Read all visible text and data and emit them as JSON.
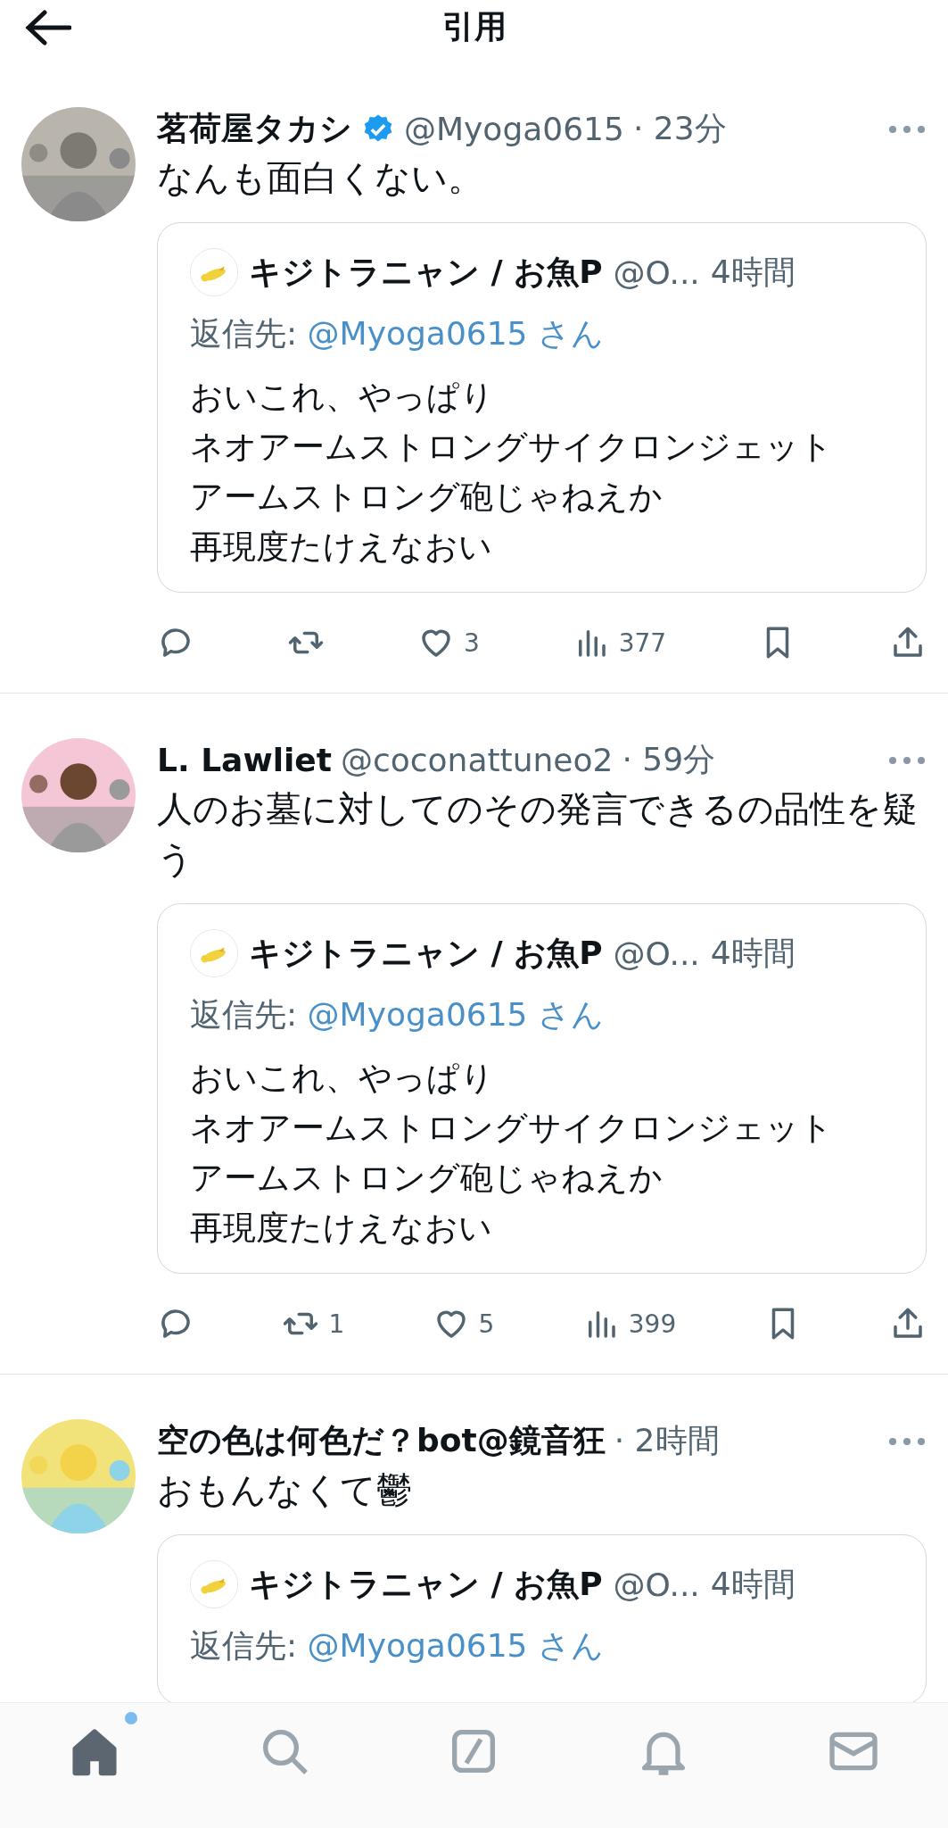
{
  "header": {
    "title": "引用"
  },
  "tweets": [
    {
      "name": "茗荷屋タカシ",
      "verified": true,
      "handle": "@Myoga0615",
      "time": "· 23分",
      "text": "なんも面白くない。",
      "quote": {
        "name": "キジトラニャン / お魚P",
        "handle": "@O...",
        "time": "4時間",
        "reply_label": "返信先:",
        "reply_to": "@Myoga0615 さん",
        "lines": [
          "おいこれ、やっぱり",
          "ネオアームストロングサイクロンジェット",
          "アームストロング砲じゃねえか",
          "再現度たけえなおい"
        ]
      },
      "actions": [
        {
          "kind": "reply"
        },
        {
          "kind": "retweet"
        },
        {
          "kind": "like",
          "count": "3"
        },
        {
          "kind": "views",
          "count": "377"
        },
        {
          "kind": "bookmark"
        },
        {
          "kind": "share"
        }
      ]
    },
    {
      "name": "L. Lawliet",
      "handle": "@coconattuneo2",
      "time": "· 59分",
      "text": "人のお墓に対してのその発言できるの品性を疑う",
      "quote": {
        "name": "キジトラニャン / お魚P",
        "handle": "@O...",
        "time": "4時間",
        "reply_label": "返信先:",
        "reply_to": "@Myoga0615 さん",
        "lines": [
          "おいこれ、やっぱり",
          "ネオアームストロングサイクロンジェット",
          "アームストロング砲じゃねえか",
          "再現度たけえなおい"
        ]
      },
      "actions": [
        {
          "kind": "reply"
        },
        {
          "kind": "retweet",
          "count": "1"
        },
        {
          "kind": "like",
          "count": "5"
        },
        {
          "kind": "views",
          "count": "399"
        },
        {
          "kind": "bookmark"
        },
        {
          "kind": "share"
        }
      ]
    },
    {
      "name": "空の色は何色だ？bot@鏡音狂",
      "time": "· 2時間",
      "text": "おもんなくて鬱",
      "quote": {
        "name": "キジトラニャン / お魚P",
        "handle": "@O...",
        "time": "4時間",
        "reply_label": "返信先:",
        "reply_to": "@Myoga0615 さん"
      }
    }
  ],
  "tab_bar": [
    {
      "kind": "home",
      "selected": true,
      "unread": true
    },
    {
      "kind": "search",
      "selected": false
    },
    {
      "kind": "compose",
      "selected": false
    },
    {
      "kind": "notifications",
      "selected": false
    },
    {
      "kind": "messages",
      "selected": false
    }
  ]
}
